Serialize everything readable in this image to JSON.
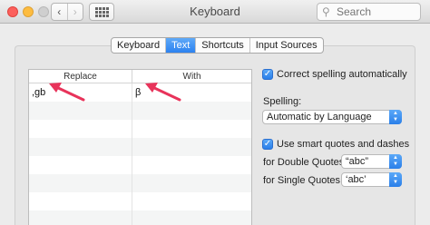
{
  "window": {
    "title": "Keyboard",
    "search_placeholder": "Search",
    "nav_back": "‹",
    "nav_forward": "›"
  },
  "tabs": [
    {
      "label": "Keyboard",
      "active": false
    },
    {
      "label": "Text",
      "active": true
    },
    {
      "label": "Shortcuts",
      "active": false
    },
    {
      "label": "Input Sources",
      "active": false
    }
  ],
  "replacements": {
    "columns": {
      "replace": "Replace",
      "with": "With"
    },
    "rows": [
      {
        "replace": ",gb",
        "with": "β"
      }
    ]
  },
  "options": {
    "correct_spelling": {
      "label": "Correct spelling automatically",
      "checked": true
    },
    "spelling_label": "Spelling:",
    "spelling_value": "Automatic by Language",
    "smart_quotes": {
      "label": "Use smart quotes and dashes",
      "checked": true
    },
    "double_quotes_label": "for Double Quotes",
    "double_quotes_value": "“abc”",
    "single_quotes_label": "for Single Quotes",
    "single_quotes_value": "‘abc’"
  },
  "colors": {
    "accent": "#2c82f0",
    "annotation": "#e8335a"
  }
}
